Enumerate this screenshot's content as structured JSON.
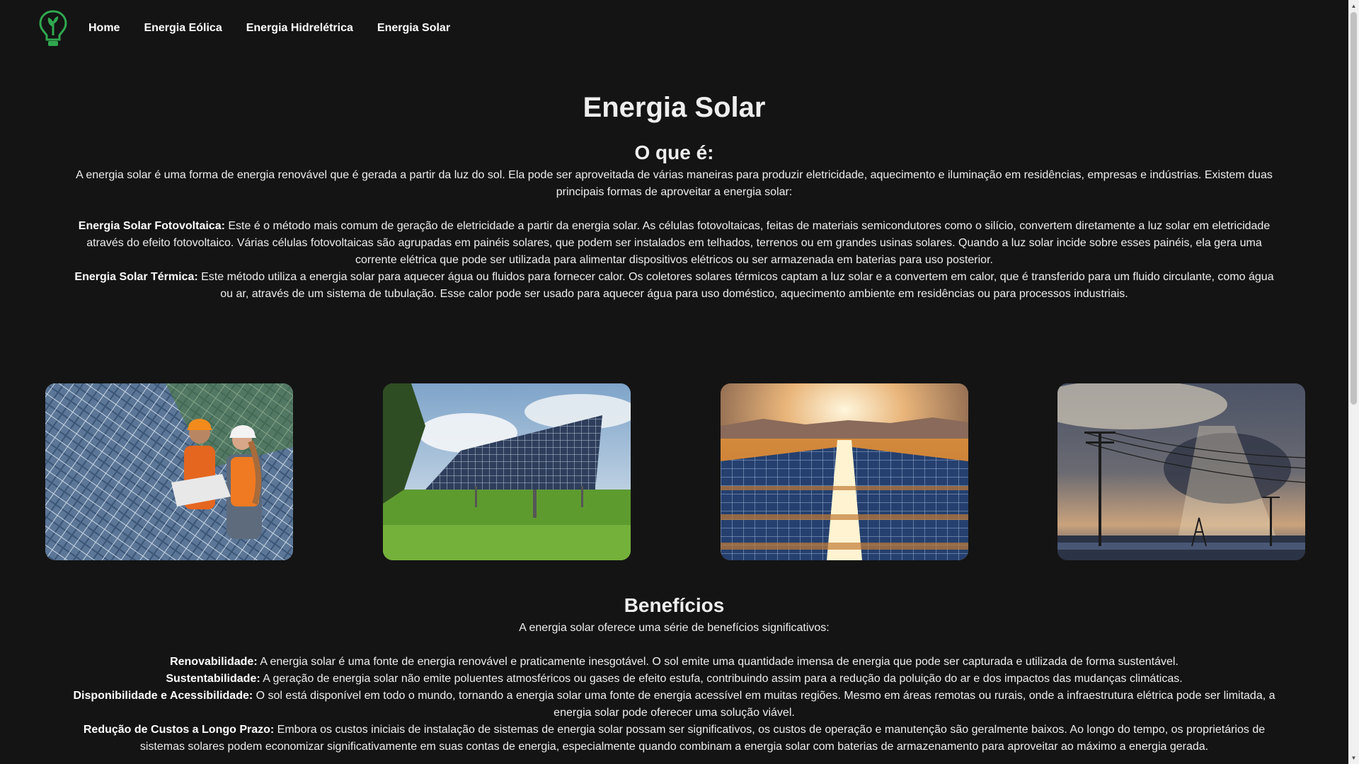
{
  "nav": {
    "logo_icon": "lightbulb-leaf-icon",
    "links": [
      "Home",
      "Energia Eólica",
      "Energia Hidrelétrica",
      "Energia Solar"
    ]
  },
  "page_title": "Energia Solar",
  "que_e": {
    "heading": "O que é:",
    "intro": "A energia solar é uma forma de energia renovável que é gerada a partir da luz do sol. Ela pode ser aproveitada de várias maneiras para produzir eletricidade, aquecimento e iluminação em residências, empresas e indústrias. Existem duas principais formas de aproveitar a energia solar:",
    "items": [
      {
        "label": "Energia Solar Fotovoltaica:",
        "text": " Este é o método mais comum de geração de eletricidade a partir da energia solar. As células fotovoltaicas, feitas de materiais semicondutores como o silício, convertem diretamente a luz solar em eletricidade através do efeito fotovoltaico. Várias células fotovoltaicas são agrupadas em painéis solares, que podem ser instalados em telhados, terrenos ou em grandes usinas solares. Quando a luz solar incide sobre esses painéis, ela gera uma corrente elétrica que pode ser utilizada para alimentar dispositivos elétricos ou ser armazenada em baterias para uso posterior."
      },
      {
        "label": "Energia Solar Térmica:",
        "text": " Este método utiliza a energia solar para aquecer água ou fluidos para fornecer calor. Os coletores solares térmicos captam a luz solar e a convertem em calor, que é transferido para um fluido circulante, como água ou ar, através de um sistema de tubulação. Esse calor pode ser usado para aquecer água para uso doméstico, aquecimento ambiente em residências ou para processos industriais."
      }
    ]
  },
  "gallery": [
    {
      "name": "photo-engineers-solar-panels"
    },
    {
      "name": "photo-solar-tracker-field"
    },
    {
      "name": "photo-desert-solar-farm"
    },
    {
      "name": "photo-power-lines-sunset"
    }
  ],
  "beneficios": {
    "heading": "Benefícios",
    "intro": "A energia solar oferece uma série de benefícios significativos:",
    "items": [
      {
        "label": "Renovabilidade:",
        "text": " A energia solar é uma fonte de energia renovável e praticamente inesgotável. O sol emite uma quantidade imensa de energia que pode ser capturada e utilizada de forma sustentável."
      },
      {
        "label": "Sustentabilidade:",
        "text": " A geração de energia solar não emite poluentes atmosféricos ou gases de efeito estufa, contribuindo assim para a redução da poluição do ar e dos impactos das mudanças climáticas."
      },
      {
        "label": "Disponibilidade e Acessibilidade:",
        "text": " O sol está disponível em todo o mundo, tornando a energia solar uma fonte de energia acessível em muitas regiões. Mesmo em áreas remotas ou rurais, onde a infraestrutura elétrica pode ser limitada, a energia solar pode oferecer uma solução viável."
      },
      {
        "label": "Redução de Custos a Longo Prazo:",
        "text": " Embora os custos iniciais de instalação de sistemas de energia solar possam ser significativos, os custos de operação e manutenção são geralmente baixos. Ao longo do tempo, os proprietários de sistemas solares podem economizar significativamente em suas contas de energia, especialmente quando combinam a energia solar com baterias de armazenamento para aproveitar ao máximo a energia gerada."
      }
    ]
  }
}
